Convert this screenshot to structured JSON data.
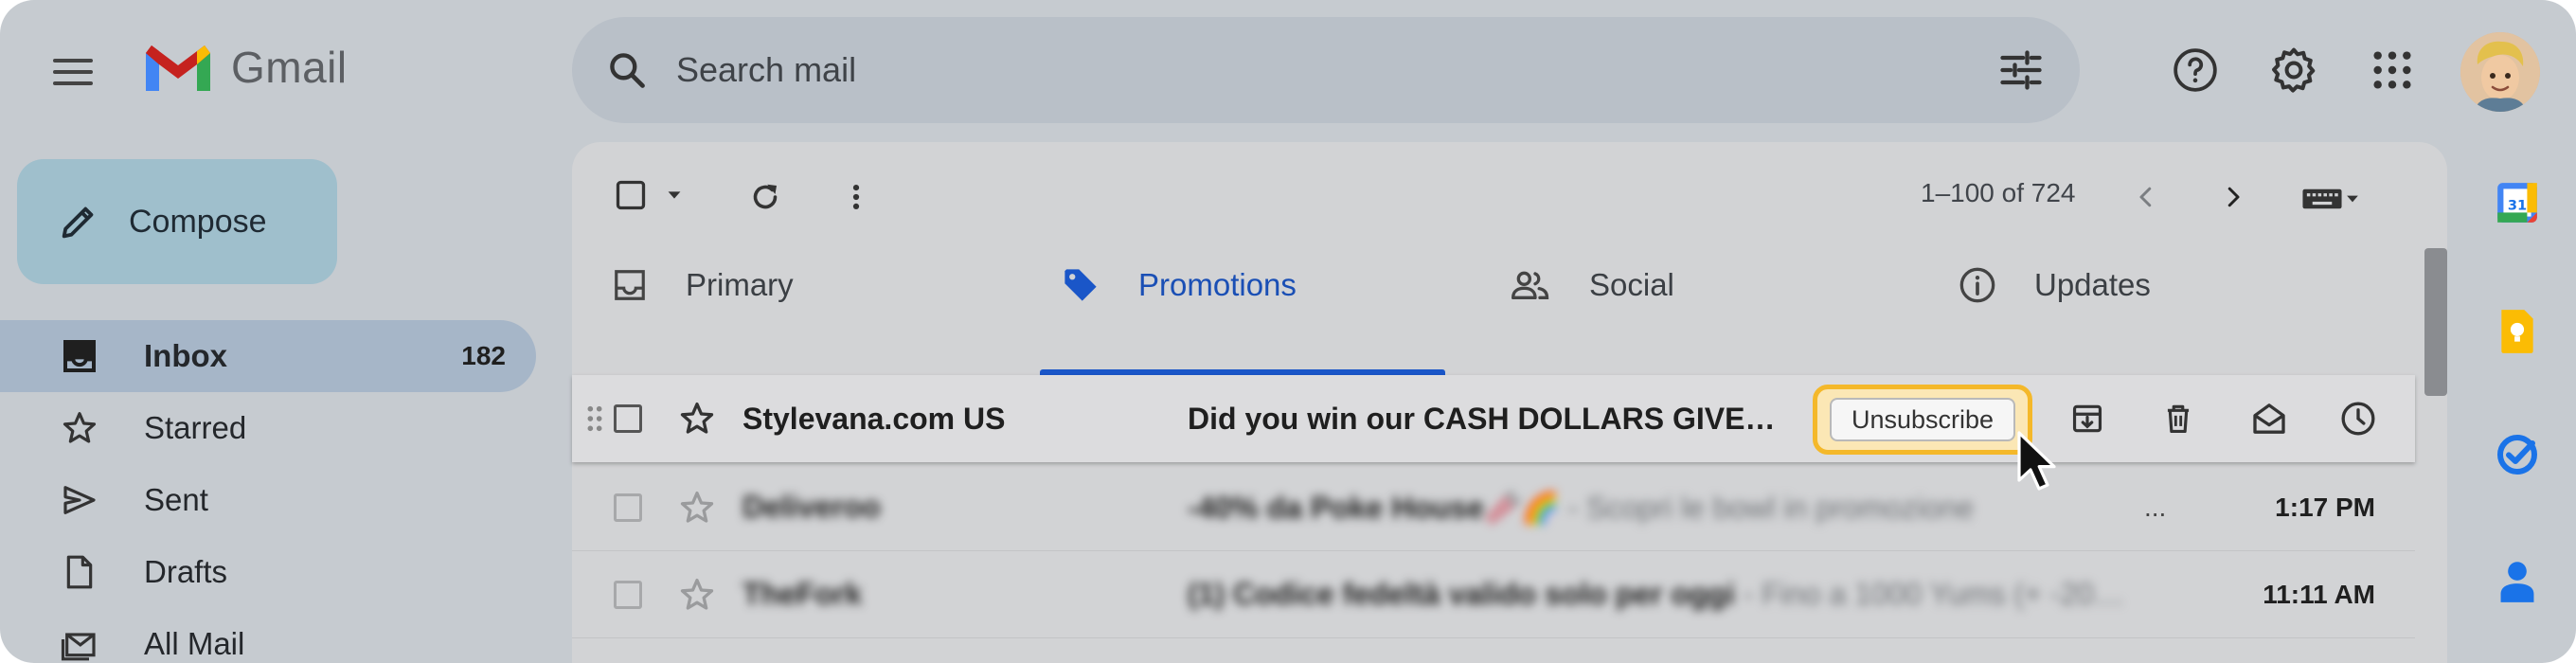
{
  "app": {
    "name": "Gmail"
  },
  "search": {
    "placeholder": "Search mail"
  },
  "compose": {
    "label": "Compose"
  },
  "sidebar": {
    "items": [
      {
        "label": "Inbox",
        "count": "182",
        "icon": "inbox-icon",
        "active": true
      },
      {
        "label": "Starred",
        "count": "",
        "icon": "star-icon"
      },
      {
        "label": "Sent",
        "count": "",
        "icon": "send-icon"
      },
      {
        "label": "Drafts",
        "count": "",
        "icon": "draft-icon"
      },
      {
        "label": "All Mail",
        "count": "",
        "icon": "all-mail-icon"
      }
    ]
  },
  "toolbar": {
    "pager_text": "1–100 of 724"
  },
  "tabs": [
    {
      "label": "Primary",
      "icon": "inbox-icon"
    },
    {
      "label": "Promotions",
      "icon": "tag-icon",
      "active": true
    },
    {
      "label": "Social",
      "icon": "people-icon"
    },
    {
      "label": "Updates",
      "icon": "info-icon"
    }
  ],
  "emails": [
    {
      "sender": "Stylevana.com US",
      "subject": "Did you win our CASH DOLLARS GIVE…",
      "snippet": "",
      "time": "",
      "hover_action": "Unsubscribe"
    },
    {
      "sender": "Deliveroo",
      "subject": "-40% da Poke House🥢🌈",
      "snippet": " - Scopri le bowl in promozione",
      "more": "...",
      "time": "1:17 PM"
    },
    {
      "sender": "TheFork",
      "subject": "(1) Codice fedeltà valido solo per oggi",
      "snippet": " - Fino a 1000 Yums (+ -20…",
      "time": "11:11 AM"
    }
  ],
  "colors": {
    "accent": "#1a56c8",
    "highlight": "#f4b82a"
  }
}
